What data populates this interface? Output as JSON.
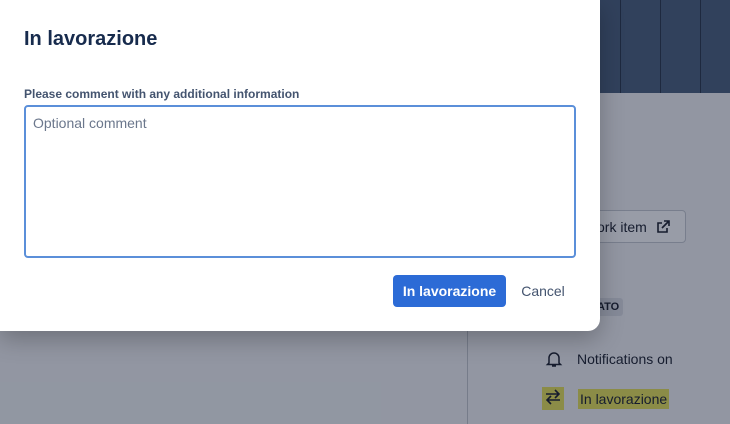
{
  "modal": {
    "title": "In lavorazione",
    "field_label": "Please comment with any additional information",
    "comment_placeholder": "Optional comment",
    "comment_value": "",
    "primary_label": "In lavorazione",
    "cancel_label": "Cancel"
  },
  "background": {
    "work_item_label": "ork item",
    "badge_label": "ATO",
    "notifications_label": "Notifications on",
    "status_label": "In lavorazione"
  },
  "colors": {
    "primary": "#2c6bd6",
    "focus_border": "#5b8fd9",
    "highlight": "#e8e35a"
  }
}
